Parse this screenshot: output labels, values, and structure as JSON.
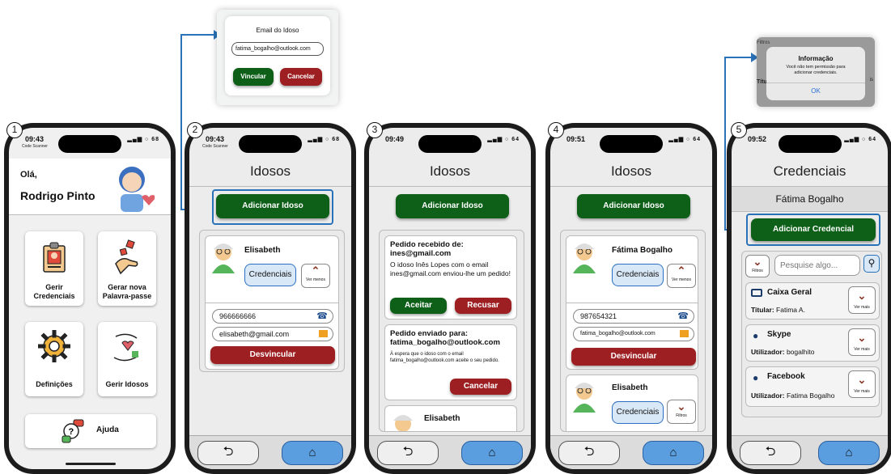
{
  "popup_email": {
    "label": "Email do Idoso",
    "value": "fatima_bogalho@outlook.com",
    "confirm": "Vincular",
    "cancel": "Cancelar"
  },
  "popup_info": {
    "bg_top": "Filtros",
    "title": "Informação",
    "message": "Você não tem permissão para adicionar credenciais.",
    "ok": "OK",
    "bg_side": "Títu",
    "bg_side2": "is"
  },
  "colors": {
    "green": "#0e6018",
    "red": "#9e1f22",
    "blue": "#2a72b8",
    "home": "#5a9ee0"
  },
  "s1": {
    "num": "1",
    "time": "09:43",
    "sub": "Code Scanner",
    "status": "▂▄▆ ○ 68",
    "greeting": "Olá,",
    "name": "Rodrigo Pinto",
    "tiles": [
      {
        "label": "Gerir Credenciais",
        "icon": "id-badge-icon"
      },
      {
        "label": "Gerar nova Palavra-passe",
        "icon": "key-hand-icon"
      },
      {
        "label": "Definições",
        "icon": "gear-icon"
      },
      {
        "label": "Gerir Idosos",
        "icon": "heart-hands-icon"
      }
    ],
    "help": "Ajuda"
  },
  "s2": {
    "num": "2",
    "time": "09:43",
    "sub": "Code Scanner",
    "status": "▂▄▆ ○ 68",
    "title": "Idosos",
    "add": "Adicionar Idoso",
    "person": "Elisabeth",
    "creds": "Credenciais",
    "ver_menos": "Ver menos",
    "phone": "966666666",
    "email": "elisabeth@gmail.com",
    "unlink": "Desvincular",
    "back": "⮌",
    "home": "⌂"
  },
  "s3": {
    "num": "3",
    "time": "09:49",
    "status": "▂▄▆ ○ 64",
    "title": "Idosos",
    "add": "Adicionar Idoso",
    "recv_title": "Pedido recebido de: ines@gmail.com",
    "recv_msg": "O idoso Inês Lopes com o email ines@gmail.com enviou-lhe um pedido!",
    "accept": "Aceitar",
    "refuse": "Recusar",
    "sent_title": "Pedido enviado para: fatima_bogalho@outlook.com",
    "sent_msg": "À espera que o idoso com o email fatima_bogalho@outlook.com aceite o seu pedido.",
    "cancel": "Cancelar",
    "next_person": "Elisabeth"
  },
  "s4": {
    "num": "4",
    "time": "09:51",
    "status": "▂▄▆ ○ 64",
    "title": "Idosos",
    "add": "Adicionar Idoso",
    "person": "Fátima Bogalho",
    "creds": "Credenciais",
    "ver_menos": "Ver menos",
    "phone": "987654321",
    "email": "fatima_bogalho@outlook.com",
    "unlink": "Desvincular",
    "person2": "Elisabeth",
    "creds2": "Credenciais",
    "filtros": "Filtros"
  },
  "s5": {
    "num": "5",
    "time": "09:52",
    "status": "▂▄▆ ○ 64",
    "title": "Credenciais",
    "owner": "Fátima Bogalho",
    "add": "Adicionar Credencial",
    "filtros": "Filtros",
    "search_ph": "Pesquise algo...",
    "items": [
      {
        "name": "Caixa Geral",
        "field": "Titular:",
        "value": "Fatima A.",
        "more": "Ver mais"
      },
      {
        "name": "Skype",
        "field": "Utilizador:",
        "value": "bogalhito",
        "more": "Ver mais"
      },
      {
        "name": "Facebook",
        "field": "Utilizador:",
        "value": "Fatima Bogalho",
        "more": "Ver mais"
      }
    ]
  }
}
